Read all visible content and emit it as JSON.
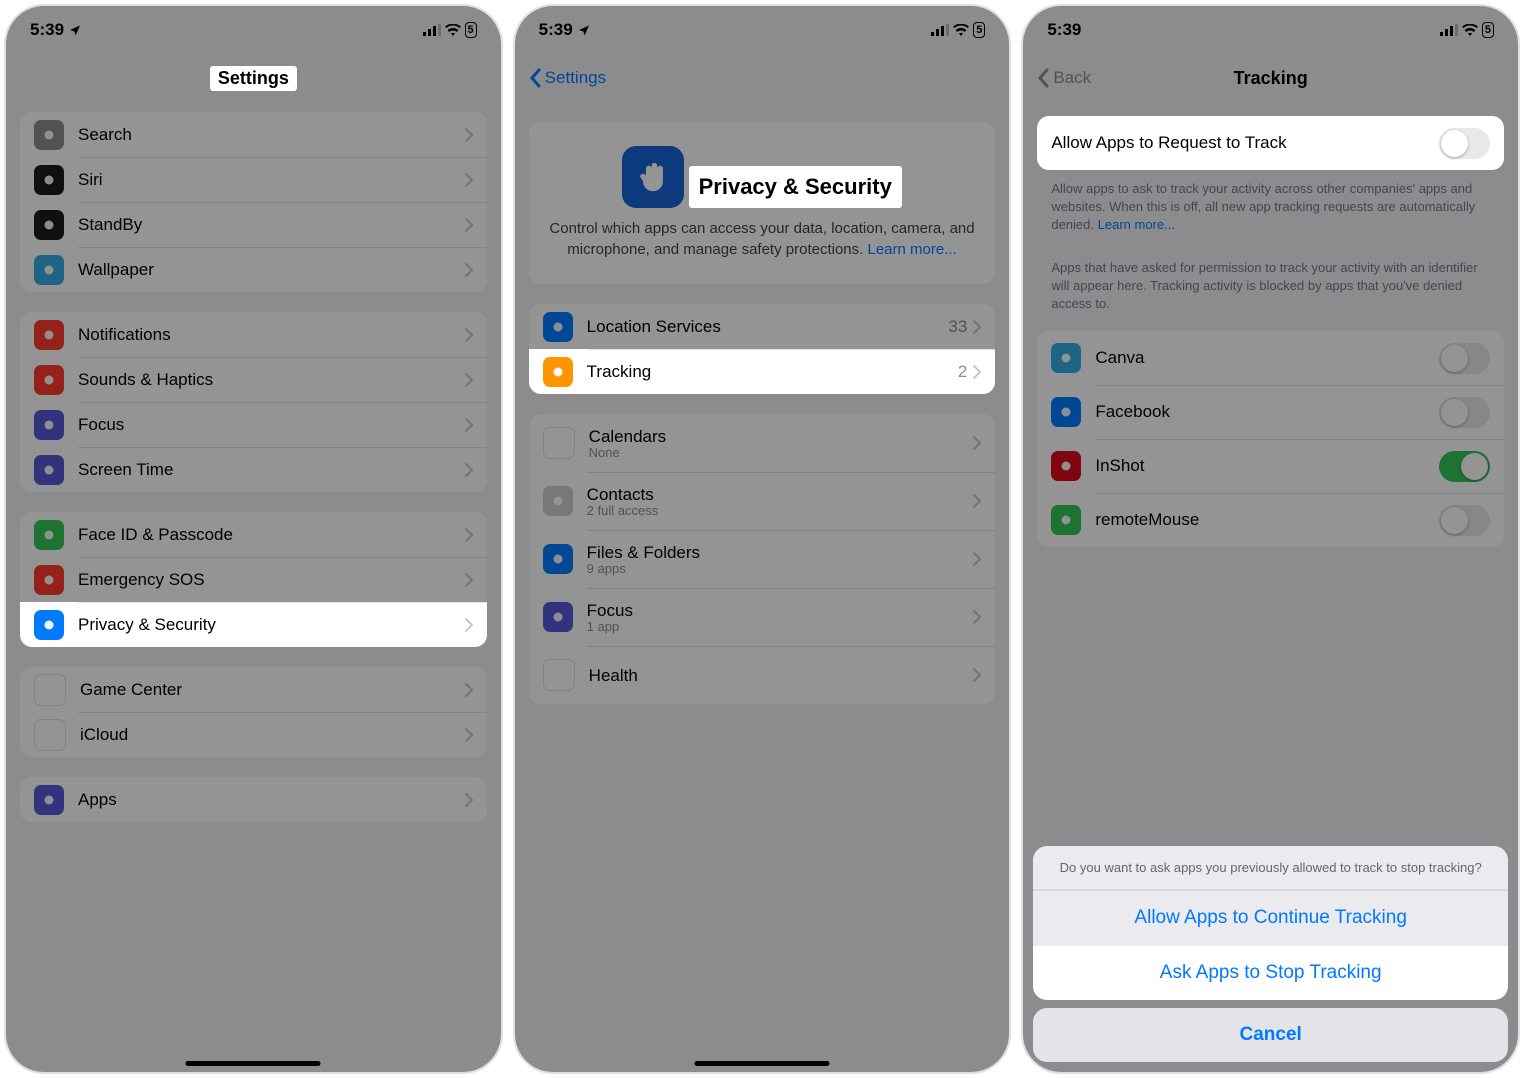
{
  "status": {
    "time": "5:39",
    "battery": "5"
  },
  "screen1": {
    "title": "Settings",
    "groups": [
      [
        {
          "label": "Search",
          "icon": "search-icon",
          "bg": "bg-gray"
        },
        {
          "label": "Siri",
          "icon": "siri-icon",
          "bg": "bg-black"
        },
        {
          "label": "StandBy",
          "icon": "standby-icon",
          "bg": "bg-black"
        },
        {
          "label": "Wallpaper",
          "icon": "wallpaper-icon",
          "bg": "bg-teal"
        }
      ],
      [
        {
          "label": "Notifications",
          "icon": "bell-icon",
          "bg": "bg-red"
        },
        {
          "label": "Sounds & Haptics",
          "icon": "speaker-icon",
          "bg": "bg-red"
        },
        {
          "label": "Focus",
          "icon": "moon-icon",
          "bg": "bg-purple"
        },
        {
          "label": "Screen Time",
          "icon": "hourglass-icon",
          "bg": "bg-purple"
        }
      ],
      [
        {
          "label": "Face ID & Passcode",
          "icon": "faceid-icon",
          "bg": "bg-green"
        },
        {
          "label": "Emergency SOS",
          "icon": "sos-icon",
          "bg": "bg-red"
        },
        {
          "label": "Privacy & Security",
          "icon": "hand-icon",
          "bg": "bg-blue",
          "highlight": true
        }
      ],
      [
        {
          "label": "Game Center",
          "icon": "game-icon",
          "bg": "bg-white"
        },
        {
          "label": "iCloud",
          "icon": "cloud-icon",
          "bg": "bg-white"
        }
      ],
      [
        {
          "label": "Apps",
          "icon": "apps-icon",
          "bg": "bg-purple"
        }
      ]
    ]
  },
  "screen2": {
    "back": "Settings",
    "header": {
      "title": "Privacy & Security",
      "sub": "Control which apps can access your data, location, camera, and microphone, and manage safety protections.",
      "learn": "Learn more..."
    },
    "rows_a": [
      {
        "label": "Location Services",
        "value": "33",
        "icon": "location-icon",
        "bg": "bg-blue"
      },
      {
        "label": "Tracking",
        "value": "2",
        "icon": "tracking-icon",
        "bg": "bg-orange",
        "highlight": true
      }
    ],
    "rows_b": [
      {
        "label": "Calendars",
        "sub": "None",
        "icon": "calendar-icon",
        "bg": "bg-white"
      },
      {
        "label": "Contacts",
        "sub": "2 full access",
        "icon": "contacts-icon",
        "bg": "bg-lgray"
      },
      {
        "label": "Files & Folders",
        "sub": "9 apps",
        "icon": "folder-icon",
        "bg": "bg-blue"
      },
      {
        "label": "Focus",
        "sub": "1 app",
        "icon": "moon-icon",
        "bg": "bg-purple"
      },
      {
        "label": "Health",
        "sub": "",
        "icon": "heart-icon",
        "bg": "bg-white"
      }
    ]
  },
  "screen3": {
    "back": "Back",
    "title": "Tracking",
    "toggle_label": "Allow Apps to Request to Track",
    "foot1": "Allow apps to ask to track your activity across other companies' apps and websites. When this is off, all new app tracking requests are automatically denied.",
    "learn": "Learn more...",
    "foot2": "Apps that have asked for permission to track your activity with an identifier will appear here. Tracking activity is blocked by apps that you've denied access to.",
    "apps": [
      {
        "label": "Canva",
        "bg": "bg-teal",
        "on": false
      },
      {
        "label": "Facebook",
        "bg": "bg-blue",
        "on": false
      },
      {
        "label": "InShot",
        "bg": "bg-dred",
        "on": true
      },
      {
        "label": "remoteMouse",
        "bg": "bg-green",
        "on": false
      }
    ],
    "sheet": {
      "msg": "Do you want to ask apps you previously allowed to track to stop tracking?",
      "opt1": "Allow Apps to Continue Tracking",
      "opt2": "Ask Apps to Stop Tracking",
      "cancel": "Cancel"
    }
  }
}
